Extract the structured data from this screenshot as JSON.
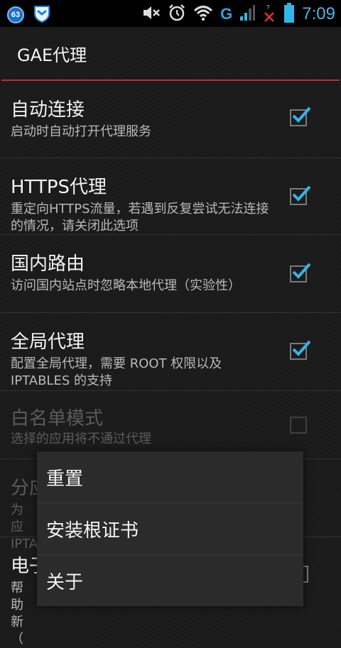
{
  "statusbar": {
    "badge": "63",
    "network_type": "G",
    "clock": "7:09"
  },
  "actionbar": {
    "title": "GAE代理"
  },
  "settings": [
    {
      "title": "自动连接",
      "summary": "启动时自动打开代理服务",
      "checked": true,
      "enabled": true
    },
    {
      "title": "HTTPS代理",
      "summary": "重定向HTTPS流量，若遇到反复尝试无法连接的情况，请关闭此选项",
      "checked": true,
      "enabled": true
    },
    {
      "title": "国内路由",
      "summary": "访问国内站点时忽略本地代理（实验性）",
      "checked": true,
      "enabled": true
    },
    {
      "title": "全局代理",
      "summary": "配置全局代理，需要 ROOT 权限以及 IPTABLES 的支持",
      "checked": true,
      "enabled": true
    },
    {
      "title": "白名单模式",
      "summary": "选择的应用将不通过代理",
      "checked": false,
      "enabled": false
    },
    {
      "title": "分应",
      "summary": "为应 IPTA",
      "checked": false,
      "enabled": false
    },
    {
      "title": "电子",
      "summary": "帮助 新（",
      "checked": false,
      "enabled": true
    }
  ],
  "menu": {
    "items": [
      "重置",
      "安装根证书",
      "关于"
    ]
  },
  "colors": {
    "accent_red": "#c62a34",
    "holo_blue": "#33b5e5"
  }
}
